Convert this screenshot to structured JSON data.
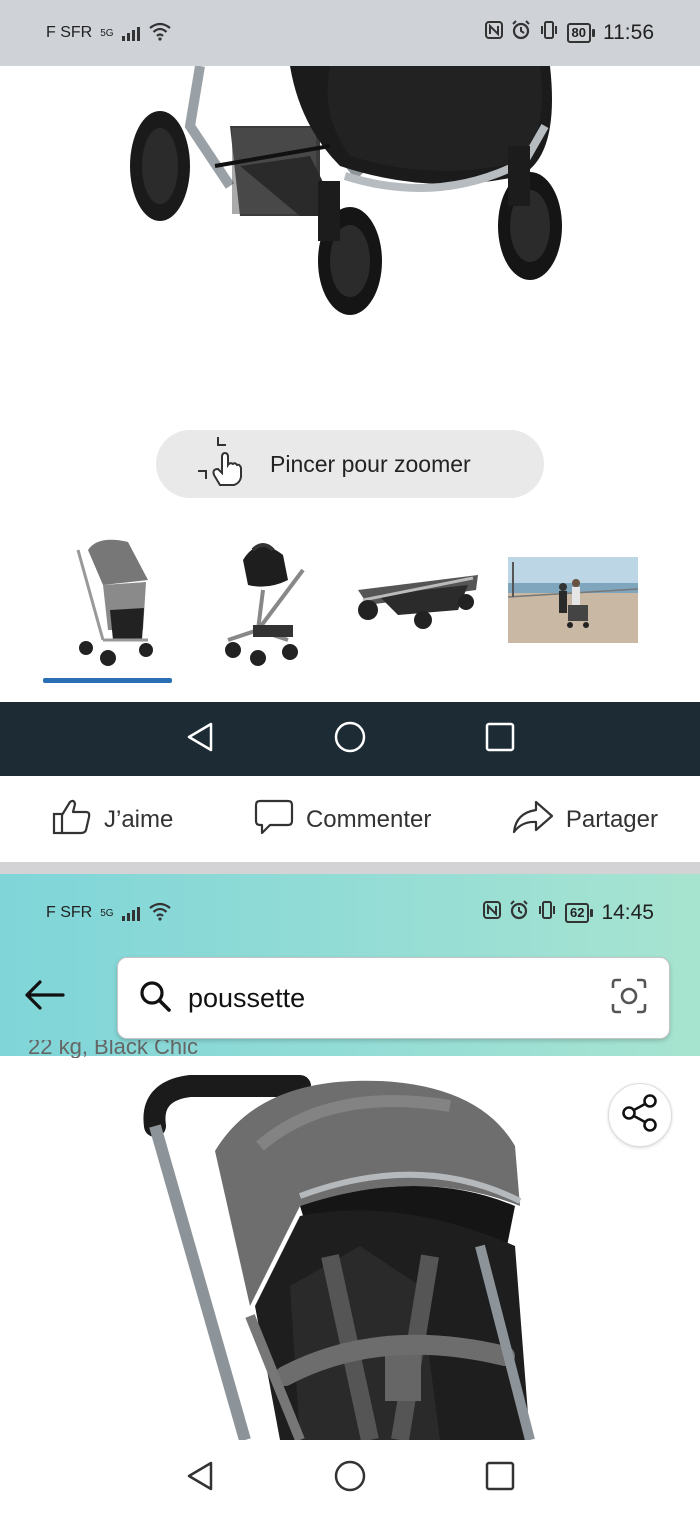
{
  "status_bar_top": {
    "carrier": "F SFR",
    "network": "5G",
    "battery": "80",
    "time": "11:56"
  },
  "pinch_hint": {
    "label": "Pincer pour zoomer"
  },
  "thumbnails": [
    {
      "name": "stroller-seat-thumb"
    },
    {
      "name": "car-seat-thumb"
    },
    {
      "name": "folded-stroller-thumb"
    },
    {
      "name": "lifestyle-photo-thumb"
    }
  ],
  "actions": {
    "like": "J’aime",
    "comment": "Commenter",
    "share": "Partager"
  },
  "status_bar_bottom": {
    "carrier": "F SFR",
    "network": "5G",
    "battery": "62",
    "time": "14:45"
  },
  "search": {
    "value": "poussette"
  },
  "peek_text": "22 kg, Black Chic",
  "colors": {
    "nav_dark": "#1d2b34",
    "accent_underline": "#2a6fb6",
    "header_gradient": "#93dcd6"
  },
  "icons": [
    "back-arrow-icon",
    "search-icon",
    "camera-lens-icon",
    "share-icon",
    "thumbs-up-icon",
    "comment-icon",
    "share-arrow-icon",
    "pinch-hand-icon",
    "nav-back-icon",
    "nav-home-icon",
    "nav-recents-icon"
  ]
}
